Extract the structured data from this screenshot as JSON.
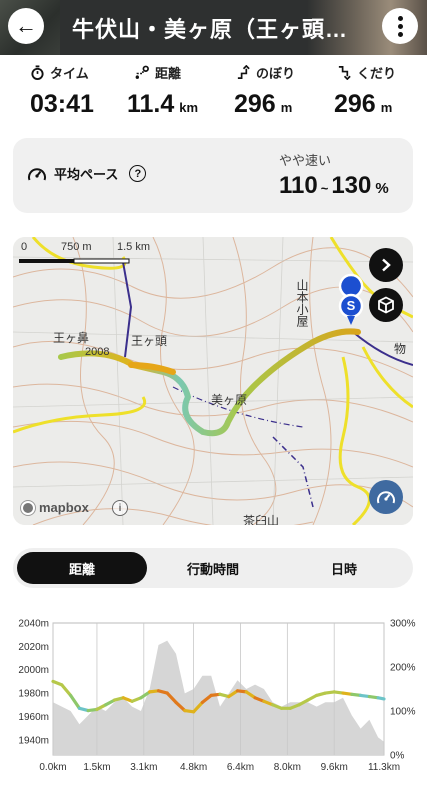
{
  "header": {
    "title": "牛伏山・美ヶ原（王ヶ頭…",
    "back_icon": "←"
  },
  "stats": [
    {
      "icon": "stopwatch-icon",
      "label": "タイム",
      "value": "03:41",
      "unit": ""
    },
    {
      "icon": "route-distance-icon",
      "label": "距離",
      "value": "11.4",
      "unit": "km"
    },
    {
      "icon": "ascent-icon",
      "label": "のぼり",
      "value": "296",
      "unit": "m"
    },
    {
      "icon": "descent-icon",
      "label": "くだり",
      "value": "296",
      "unit": "m"
    }
  ],
  "pace": {
    "label": "平均ペース",
    "help": "?",
    "speed_label": "やや速い",
    "min": "110",
    "tilde": "~",
    "max": "130",
    "unit": "%"
  },
  "map": {
    "scale_labels": [
      "0",
      "750 m",
      "1.5 km"
    ],
    "place_labels": [
      "王ヶ鼻",
      "2008",
      "王ヶ頭",
      "美ヶ原",
      "山本小屋",
      "物",
      "茶臼山"
    ],
    "start_marker": "S",
    "attribution": "mapbox",
    "info": "i"
  },
  "tabs": [
    {
      "label": "距離",
      "active": true
    },
    {
      "label": "行動時間",
      "active": false
    },
    {
      "label": "日時",
      "active": false
    }
  ],
  "chart_data": {
    "type": "area",
    "x_unit": "km",
    "x_ticks": [
      "0.0km",
      "1.5km",
      "3.1km",
      "4.8km",
      "6.4km",
      "8.0km",
      "9.6km",
      "11.3km"
    ],
    "y_ticks_left": [
      "2040m",
      "2020m",
      "2000m",
      "1980m",
      "1960m",
      "1940m"
    ],
    "y_ticks_right": [
      "300%",
      "200%",
      "100%",
      "0%"
    ],
    "ylim": [
      1927,
      2040
    ],
    "xlim": [
      0,
      11.3
    ],
    "series": [
      {
        "name": "elevation",
        "x": [
          0,
          0.3,
          0.6,
          0.9,
          1.2,
          1.5,
          1.8,
          2.1,
          2.4,
          2.7,
          3.0,
          3.3,
          3.6,
          3.9,
          4.2,
          4.5,
          4.8,
          5.1,
          5.4,
          5.7,
          6.0,
          6.3,
          6.6,
          6.9,
          7.2,
          7.5,
          7.8,
          8.1,
          8.4,
          8.7,
          9.0,
          9.3,
          9.6,
          9.9,
          10.2,
          10.5,
          10.8,
          11.1,
          11.3
        ],
        "values": [
          1990,
          1987,
          1978,
          1967,
          1965,
          1966,
          1970,
          1974,
          1976,
          1973,
          1976,
          1981,
          1982,
          1980,
          1972,
          1965,
          1964,
          1972,
          1978,
          1979,
          1977,
          1982,
          1981,
          1976,
          1973,
          1970,
          1967,
          1967,
          1970,
          1974,
          1978,
          1980,
          1981,
          1980,
          1979,
          1978,
          1977,
          1976,
          1975
        ]
      },
      {
        "name": "pace",
        "unit": "%",
        "x": [
          0,
          0.3,
          0.6,
          0.9,
          1.2,
          1.5,
          1.8,
          2.1,
          2.4,
          2.7,
          3.0,
          3.3,
          3.6,
          3.9,
          4.2,
          4.5,
          4.8,
          5.1,
          5.4,
          5.7,
          6.0,
          6.3,
          6.6,
          6.9,
          7.2,
          7.5,
          7.8,
          8.1,
          8.4,
          8.7,
          9.0,
          9.3,
          9.6,
          9.9,
          10.2,
          10.5,
          10.8,
          11.1,
          11.3
        ],
        "values": [
          120,
          110,
          100,
          70,
          90,
          110,
          100,
          120,
          130,
          110,
          100,
          150,
          250,
          260,
          230,
          140,
          150,
          180,
          180,
          110,
          140,
          170,
          150,
          160,
          150,
          120,
          110,
          120,
          120,
          120,
          110,
          120,
          120,
          130,
          90,
          60,
          80,
          40,
          30
        ]
      }
    ]
  }
}
